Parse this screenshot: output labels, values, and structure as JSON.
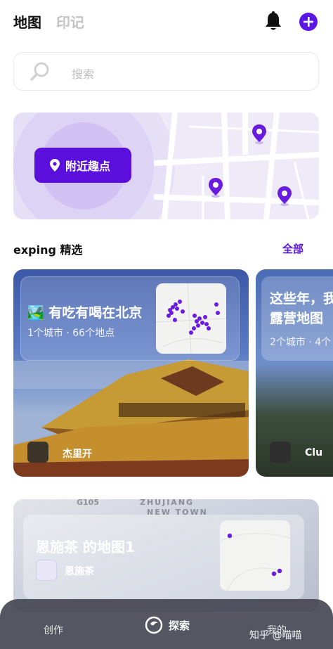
{
  "header": {
    "tab_active": "地图",
    "tab_inactive": "印记",
    "bell_icon": "bell-icon",
    "add_icon": "plus-icon"
  },
  "search": {
    "placeholder": "搜索"
  },
  "map_card": {
    "button_label": "附近趣点"
  },
  "section": {
    "title": "exping 精选",
    "all_label": "全部"
  },
  "featured": [
    {
      "emoji": "🏞️",
      "title": "有吃有喝在北京",
      "meta": "1个城市 · 66个地点",
      "author": "杰里开"
    },
    {
      "title_line1": "这些年，我",
      "title_line2": "露营地图",
      "meta": "2个城市 · 4个",
      "author": "Clu"
    }
  ],
  "lower_card": {
    "title": "恩施茶 的地图1",
    "user": "恩施茶",
    "street_1": "ZHUJIANG",
    "street_2": "NEW TOWN",
    "road_code": "G105"
  },
  "bottom_nav": {
    "create": "创作",
    "explore": "探索",
    "mine": "我的"
  },
  "watermark": "知乎 @喵喵",
  "colors": {
    "accent": "#5b16e6"
  }
}
